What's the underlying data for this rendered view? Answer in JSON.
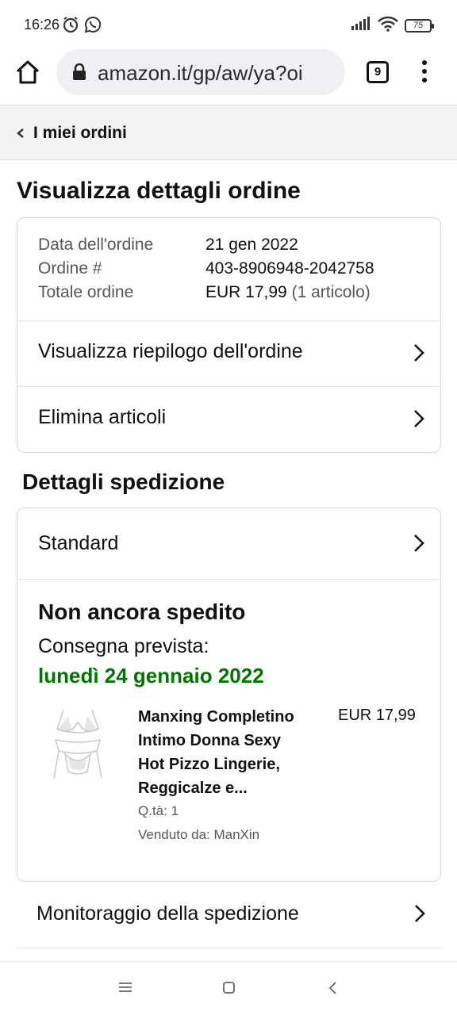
{
  "status_bar": {
    "time": "16:26",
    "battery": "75",
    "icons": [
      "alarm-icon",
      "whatsapp-icon",
      "signal-icon",
      "wifi-icon",
      "battery-icon"
    ]
  },
  "browser": {
    "url": "amazon.it/gp/aw/ya?oi",
    "tab_count": "9"
  },
  "back_nav": {
    "label": "I miei ordini"
  },
  "page_title": "Visualizza dettagli ordine",
  "order_info": {
    "rows": [
      {
        "label": "Data dell'ordine",
        "value": "21 gen 2022"
      },
      {
        "label": "Ordine #",
        "value": "403-8906948-2042758"
      },
      {
        "label": "Totale ordine",
        "value": "EUR 17,99",
        "extra": "(1 articolo)"
      }
    ],
    "links": [
      "Visualizza riepilogo dell'ordine",
      "Elimina articoli"
    ]
  },
  "shipping": {
    "title": "Dettagli spedizione",
    "method": "Standard",
    "status": "Non ancora spedito",
    "eta_label": "Consegna prevista:",
    "eta_date": "lunedì 24 gennaio 2022",
    "eta_color": "#007600",
    "item": {
      "name_lines": [
        "Manxing Completino",
        "Intimo Donna Sexy",
        "Hot Pizzo Lingerie,",
        "Reggicalze e..."
      ],
      "price": "EUR 17,99",
      "qty": "Q.tà: 1",
      "seller": "Venduto da: ManXin"
    }
  },
  "tracking": {
    "label": "Monitoraggio della spedizione"
  }
}
